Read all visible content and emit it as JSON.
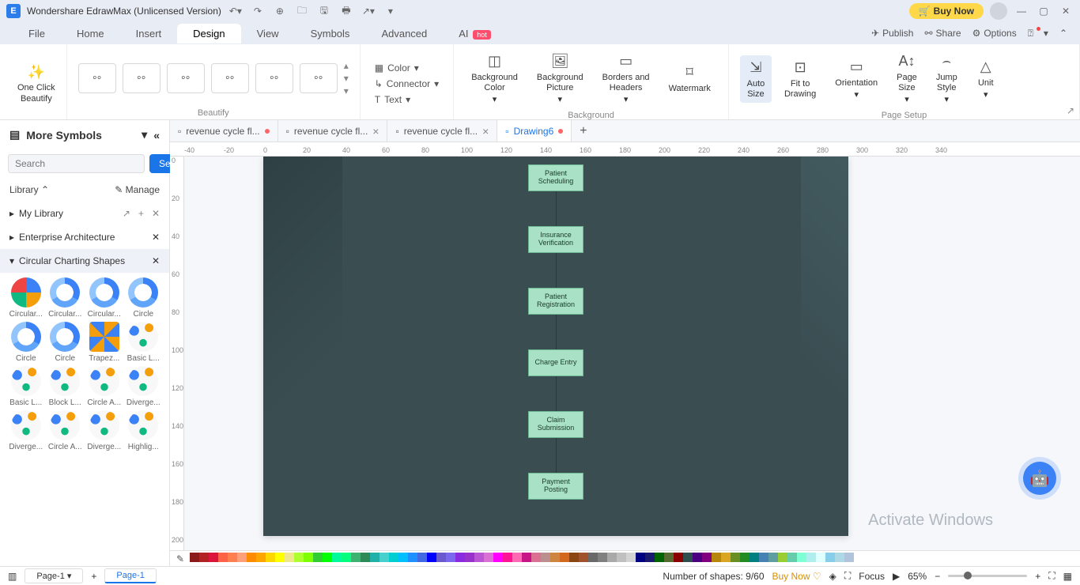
{
  "titlebar": {
    "app_name": "Wondershare EdrawMax (Unlicensed Version)",
    "buy_now": "Buy Now"
  },
  "menubar": {
    "items": [
      "File",
      "Home",
      "Insert",
      "Design",
      "View",
      "Symbols",
      "Advanced",
      "AI"
    ],
    "active": "Design",
    "hot_badge": "hot",
    "right": {
      "publish": "Publish",
      "share": "Share",
      "options": "Options"
    }
  },
  "ribbon": {
    "one_click": "One Click\nBeautify",
    "color": "Color",
    "connector": "Connector",
    "text": "Text",
    "bg_color": "Background\nColor",
    "bg_picture": "Background\nPicture",
    "borders": "Borders and\nHeaders",
    "watermark": "Watermark",
    "auto_size": "Auto\nSize",
    "fit_drawing": "Fit to\nDrawing",
    "orientation": "Orientation",
    "page_size": "Page\nSize",
    "jump_style": "Jump\nStyle",
    "unit": "Unit",
    "group_beautify": "Beautify",
    "group_background": "Background",
    "group_pagesetup": "Page Setup"
  },
  "sidebar": {
    "more_symbols": "More Symbols",
    "search_placeholder": "Search",
    "search_btn": "Search",
    "library": "Library",
    "manage": "Manage",
    "my_library": "My Library",
    "enterprise": "Enterprise Architecture",
    "circular": "Circular Charting Shapes",
    "shapes": [
      {
        "label": "Circular..."
      },
      {
        "label": "Circular..."
      },
      {
        "label": "Circular..."
      },
      {
        "label": "Circle"
      },
      {
        "label": "Circle"
      },
      {
        "label": "Circle"
      },
      {
        "label": "Trapez..."
      },
      {
        "label": "Basic L..."
      },
      {
        "label": "Basic L..."
      },
      {
        "label": "Block L..."
      },
      {
        "label": "Circle A..."
      },
      {
        "label": "Diverge..."
      },
      {
        "label": "Diverge..."
      },
      {
        "label": "Circle A..."
      },
      {
        "label": "Diverge..."
      },
      {
        "label": "Highlig..."
      }
    ]
  },
  "doc_tabs": [
    {
      "label": "revenue cycle fl...",
      "modified": true
    },
    {
      "label": "revenue cycle fl...",
      "modified": false
    },
    {
      "label": "revenue cycle fl...",
      "modified": false
    },
    {
      "label": "Drawing6",
      "modified": true,
      "active": true
    }
  ],
  "flowchart": {
    "boxes": [
      "Patient\nScheduling",
      "Insurance\nVerification",
      "Patient\nRegistration",
      "Charge Entry",
      "Claim\nSubmission",
      "Payment\nPosting"
    ]
  },
  "colors": [
    "#8b1a1a",
    "#b22222",
    "#dc143c",
    "#ff6347",
    "#ff7f50",
    "#ffa07a",
    "#ff8c00",
    "#ffa500",
    "#ffd700",
    "#ffff00",
    "#f0e68c",
    "#adff2f",
    "#7fff00",
    "#32cd32",
    "#00ff00",
    "#00fa9a",
    "#00ff7f",
    "#3cb371",
    "#2e8b57",
    "#20b2aa",
    "#48d1cc",
    "#00ced1",
    "#00bfff",
    "#1e90ff",
    "#4169e1",
    "#0000ff",
    "#6a5acd",
    "#7b68ee",
    "#8a2be2",
    "#9932cc",
    "#ba55d3",
    "#da70d6",
    "#ff00ff",
    "#ff1493",
    "#ff69b4",
    "#c71585",
    "#db7093",
    "#bc8f8f",
    "#cd853f",
    "#d2691e",
    "#8b4513",
    "#a0522d",
    "#696969",
    "#808080",
    "#a9a9a9",
    "#c0c0c0",
    "#d3d3d3",
    "#000080",
    "#191970",
    "#006400",
    "#556b2f",
    "#8b0000",
    "#2f4f4f",
    "#4b0082",
    "#800080",
    "#b8860b",
    "#daa520",
    "#6b8e23",
    "#228b22",
    "#008080",
    "#4682b4",
    "#5f9ea0",
    "#9acd32",
    "#66cdaa",
    "#7fffd4",
    "#afeeee",
    "#e0ffff",
    "#87ceeb",
    "#add8e6",
    "#b0c4de"
  ],
  "statusbar": {
    "page_label": "Page-1",
    "page_tab": "Page-1",
    "shape_count": "Number of shapes: 9/60",
    "buy_now": "Buy Now",
    "focus": "Focus",
    "zoom": "65%"
  },
  "watermark": "Activate Windows"
}
